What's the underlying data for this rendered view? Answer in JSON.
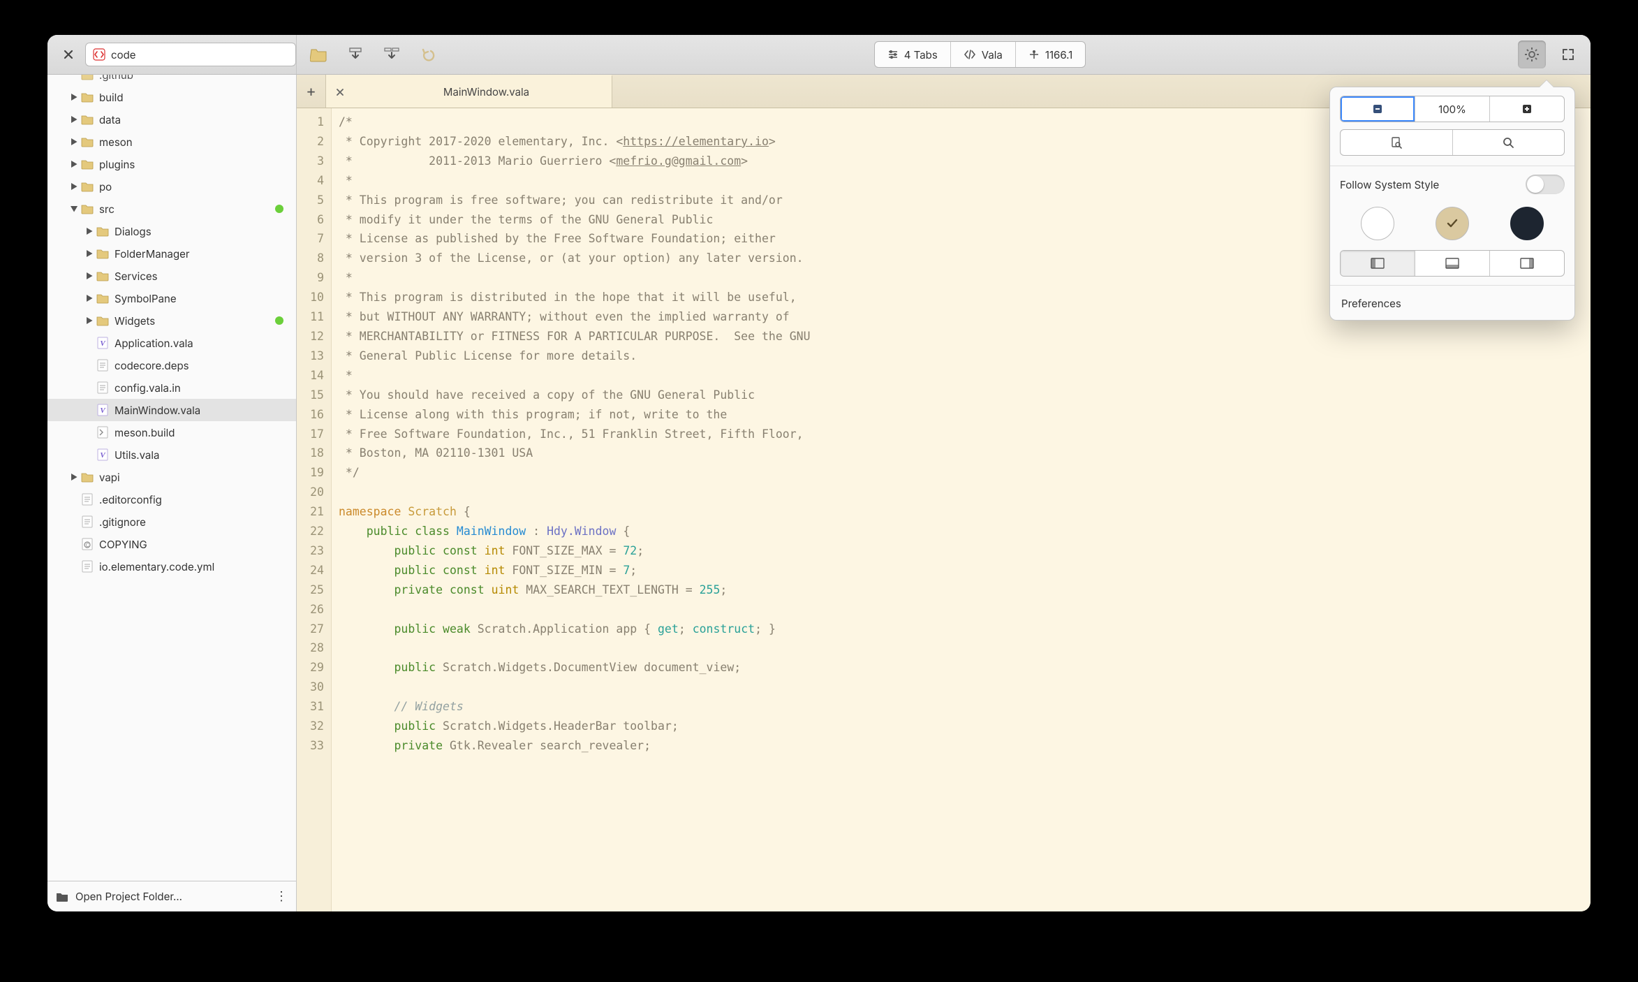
{
  "header": {
    "search_text": "code",
    "segments": {
      "tabs": "4 Tabs",
      "lang": "Vala",
      "linecol": "1166.1"
    }
  },
  "sidebar": {
    "items": [
      {
        "label": ".github",
        "depth": 1,
        "icon": "folder",
        "arrow": "",
        "truncated_top": true
      },
      {
        "label": "build",
        "depth": 1,
        "icon": "folder",
        "arrow": "right"
      },
      {
        "label": "data",
        "depth": 1,
        "icon": "folder",
        "arrow": "right"
      },
      {
        "label": "meson",
        "depth": 1,
        "icon": "folder",
        "arrow": "right"
      },
      {
        "label": "plugins",
        "depth": 1,
        "icon": "folder",
        "arrow": "right"
      },
      {
        "label": "po",
        "depth": 1,
        "icon": "folder",
        "arrow": "right"
      },
      {
        "label": "src",
        "depth": 1,
        "icon": "folder",
        "arrow": "down",
        "dot": true
      },
      {
        "label": "Dialogs",
        "depth": 2,
        "icon": "folder",
        "arrow": "right"
      },
      {
        "label": "FolderManager",
        "depth": 2,
        "icon": "folder",
        "arrow": "right"
      },
      {
        "label": "Services",
        "depth": 2,
        "icon": "folder",
        "arrow": "right"
      },
      {
        "label": "SymbolPane",
        "depth": 2,
        "icon": "folder",
        "arrow": "right"
      },
      {
        "label": "Widgets",
        "depth": 2,
        "icon": "folder",
        "arrow": "right",
        "dot": true
      },
      {
        "label": "Application.vala",
        "depth": 2,
        "icon": "vala"
      },
      {
        "label": "codecore.deps",
        "depth": 2,
        "icon": "text"
      },
      {
        "label": "config.vala.in",
        "depth": 2,
        "icon": "text"
      },
      {
        "label": "MainWindow.vala",
        "depth": 2,
        "icon": "vala",
        "selected": true
      },
      {
        "label": "meson.build",
        "depth": 2,
        "icon": "build"
      },
      {
        "label": "Utils.vala",
        "depth": 2,
        "icon": "vala"
      },
      {
        "label": "vapi",
        "depth": 1,
        "icon": "folder",
        "arrow": "right"
      },
      {
        "label": ".editorconfig",
        "depth": 1,
        "icon": "text"
      },
      {
        "label": ".gitignore",
        "depth": 1,
        "icon": "text"
      },
      {
        "label": "COPYING",
        "depth": 1,
        "icon": "copying"
      },
      {
        "label": "io.elementary.code.yml",
        "depth": 1,
        "icon": "text"
      }
    ],
    "footer_label": "Open Project Folder…"
  },
  "tabs": {
    "current": "MainWindow.vala"
  },
  "code_lines": [
    {
      "n": 1,
      "html": "/*"
    },
    {
      "n": 2,
      "html": " * Copyright 2017-2020 elementary, Inc. &lt;<a href='#'>https://elementary.io</a>&gt;"
    },
    {
      "n": 3,
      "html": " *           2011-2013 Mario Guerriero &lt;<a href='#'>mefrio.g@gmail.com</a>&gt;"
    },
    {
      "n": 4,
      "html": " *"
    },
    {
      "n": 5,
      "html": " * This program is free software; you can redistribute it and/or"
    },
    {
      "n": 6,
      "html": " * modify it under the terms of the GNU General Public"
    },
    {
      "n": 7,
      "html": " * License as published by the Free Software Foundation; either"
    },
    {
      "n": 8,
      "html": " * version 3 of the License, or (at your option) any later version."
    },
    {
      "n": 9,
      "html": " *"
    },
    {
      "n": 10,
      "html": " * This program is distributed in the hope that it will be useful,"
    },
    {
      "n": 11,
      "html": " * but WITHOUT ANY WARRANTY; without even the implied warranty of"
    },
    {
      "n": 12,
      "html": " * MERCHANTABILITY or FITNESS FOR A PARTICULAR PURPOSE.  See the GNU"
    },
    {
      "n": 13,
      "html": " * General Public License for more details."
    },
    {
      "n": 14,
      "html": " *"
    },
    {
      "n": 15,
      "html": " * You should have received a copy of the GNU General Public"
    },
    {
      "n": 16,
      "html": " * License along with this program; if not, write to the"
    },
    {
      "n": 17,
      "html": " * Free Software Foundation, Inc., 51 Franklin Street, Fifth Floor,"
    },
    {
      "n": 18,
      "html": " * Boston, MA 02110-1301 USA"
    },
    {
      "n": 19,
      "html": " */"
    },
    {
      "n": 20,
      "html": ""
    },
    {
      "n": 21,
      "html": "<span class='kw-ns'>namespace</span> <span class='kw-name'>Scratch</span> {"
    },
    {
      "n": 22,
      "html": "    <span class='kw'>public</span> <span class='kw'>class</span> <span class='classname'>MainWindow</span> : <span class='base'>Hdy.Window</span> {"
    },
    {
      "n": 23,
      "html": "        <span class='kw'>public</span> <span class='kw'>const</span> <span class='type'>int</span> FONT_SIZE_MAX = <span class='num'>72</span>;"
    },
    {
      "n": 24,
      "html": "        <span class='kw'>public</span> <span class='kw'>const</span> <span class='type'>int</span> FONT_SIZE_MIN = <span class='num'>7</span>;"
    },
    {
      "n": 25,
      "html": "        <span class='kw'>private</span> <span class='kw'>const</span> <span class='type'>uint</span> MAX_SEARCH_TEXT_LENGTH = <span class='num'>255</span>;"
    },
    {
      "n": 26,
      "html": ""
    },
    {
      "n": 27,
      "html": "        <span class='kw'>public</span> <span class='kw'>weak</span> Scratch.Application app { <span class='prop'>get</span>; <span class='prop'>construct</span>; }"
    },
    {
      "n": 28,
      "html": ""
    },
    {
      "n": 29,
      "html": "        <span class='kw'>public</span> Scratch.Widgets.DocumentView document_view;"
    },
    {
      "n": 30,
      "html": ""
    },
    {
      "n": 31,
      "html": "        <span class='comment'>// Widgets</span>"
    },
    {
      "n": 32,
      "html": "        <span class='kw'>public</span> Scratch.Widgets.HeaderBar toolbar;"
    },
    {
      "n": 33,
      "html": "        <span class='kw'>private</span> Gtk.Revealer search_revealer;"
    }
  ],
  "popover": {
    "zoom_label": "100%",
    "follow_label": "Follow System Style",
    "prefs_label": "Preferences"
  },
  "icons": {
    "code_app": "code-app-icon",
    "folder_open": "folder-open-icon"
  }
}
